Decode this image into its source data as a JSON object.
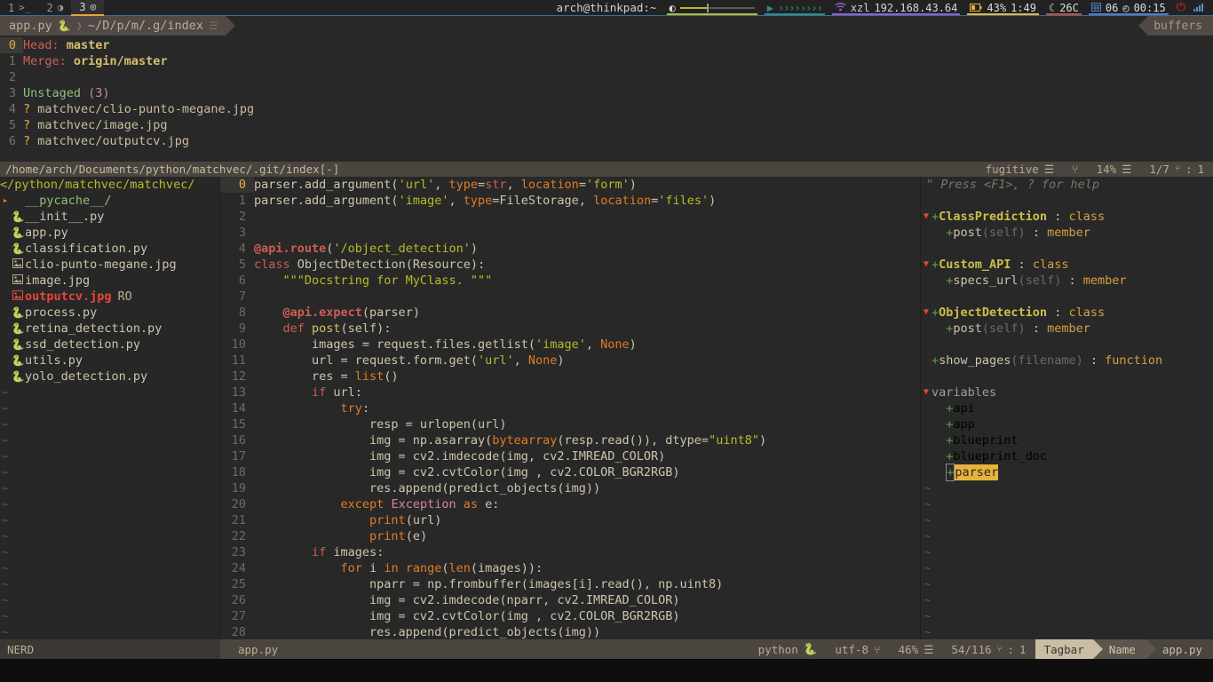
{
  "polybar": {
    "workspaces": [
      {
        "num": "1",
        "icon": ">_",
        "active": false
      },
      {
        "num": "2",
        "icon": "◑",
        "active": false
      },
      {
        "num": "3",
        "icon": "◎",
        "active": true
      }
    ],
    "window_title": "arch@thinkpad:~",
    "volume_icon": "◐",
    "audio_icon": "▶",
    "audio_wave": "››››››››",
    "wifi_icon": "wifi-icon",
    "wifi_ssid": "xzl",
    "wifi_ip": "192.168.43.64",
    "battery_icon": "battery-icon",
    "battery_percent": "43%",
    "battery_time": "1:49",
    "temp_icon": "☾",
    "temperature": "26C",
    "calendar_icon": "calendar-icon",
    "date": "06",
    "clock_icon": "◴",
    "time": "00:15",
    "power_icon": "⏻",
    "signal_icon": "signal-icon"
  },
  "tabline": {
    "tab_label": "app.py",
    "tab_icon": "python-icon",
    "tab_sep": "❯",
    "tab_path": "~/D/p/m/.g/index",
    "tab_listicon": "☰",
    "buffers_label": "buffers"
  },
  "fugitive": {
    "lines": [
      {
        "num": "0",
        "current": true,
        "kind": "kv",
        "key": "Head:",
        "value": "master"
      },
      {
        "num": "1",
        "current": false,
        "kind": "kv",
        "key": "Merge:",
        "value": "origin/master"
      },
      {
        "num": "2",
        "current": false,
        "kind": "blank"
      },
      {
        "num": "3",
        "current": false,
        "kind": "section",
        "label": "Unstaged",
        "count": "(3)"
      },
      {
        "num": "4",
        "current": false,
        "kind": "file",
        "flag": "?",
        "path": "matchvec/clio-punto-megane.jpg"
      },
      {
        "num": "5",
        "current": false,
        "kind": "file",
        "flag": "?",
        "path": "matchvec/image.jpg"
      },
      {
        "num": "6",
        "current": false,
        "kind": "file",
        "flag": "?",
        "path": "matchvec/outputcv.jpg"
      }
    ],
    "statusline": {
      "path": "/home/arch/Documents/python/matchvec/.git/index[-]",
      "filetype": "fugitive",
      "ft_icon": "☰",
      "branch_icon": "⑂",
      "percent": "14%",
      "percent_icon": "☰",
      "position": "1/7",
      "line_icon": "⑂",
      "colon": ":",
      "column": "1"
    }
  },
  "nerdtree": {
    "header": "</python/matchvec/matchvec/",
    "items": [
      {
        "icon": "folder-arrow-icon",
        "arrow": "▸",
        "label": "__pycache__/",
        "type": "dir"
      },
      {
        "icon": "python-icon",
        "label": "__init__.py",
        "type": "py"
      },
      {
        "icon": "python-icon",
        "label": "app.py",
        "type": "py"
      },
      {
        "icon": "python-icon",
        "label": "classification.py",
        "type": "py"
      },
      {
        "icon": "image-icon",
        "label": "clio-punto-megane.jpg",
        "type": "img"
      },
      {
        "icon": "image-icon",
        "label": "image.jpg",
        "type": "img"
      },
      {
        "icon": "image-icon",
        "label": "outputcv.jpg",
        "type": "img",
        "readonly": true,
        "ro_flag": "RO"
      },
      {
        "icon": "python-icon",
        "label": "process.py",
        "type": "py"
      },
      {
        "icon": "python-icon",
        "label": "retina_detection.py",
        "type": "py"
      },
      {
        "icon": "python-icon",
        "label": "ssd_detection.py",
        "type": "py"
      },
      {
        "icon": "python-icon",
        "label": "utils.py",
        "type": "py"
      },
      {
        "icon": "python-icon",
        "label": "yolo_detection.py",
        "type": "py"
      }
    ],
    "empty_marker": "~",
    "empty_rows": 16,
    "statusline_label": "NERD"
  },
  "code": {
    "filename": "app.py",
    "lines": [
      {
        "num": "0",
        "current": true,
        "tokens": [
          {
            "t": "parser.add_argument(",
            "c": "ctext"
          },
          {
            "t": "'url'",
            "c": "str"
          },
          {
            "t": ", ",
            "c": "ctext"
          },
          {
            "t": "type",
            "c": "none"
          },
          {
            "t": "=",
            "c": "ctext"
          },
          {
            "t": "str",
            "c": "kw"
          },
          {
            "t": ", ",
            "c": "ctext"
          },
          {
            "t": "location",
            "c": "none"
          },
          {
            "t": "=",
            "c": "ctext"
          },
          {
            "t": "'form'",
            "c": "str"
          },
          {
            "t": ")",
            "c": "ctext"
          }
        ]
      },
      {
        "num": "1",
        "current": false,
        "tokens": [
          {
            "t": "parser.add_argument(",
            "c": "ctext"
          },
          {
            "t": "'image'",
            "c": "str"
          },
          {
            "t": ", ",
            "c": "ctext"
          },
          {
            "t": "type",
            "c": "none"
          },
          {
            "t": "=",
            "c": "ctext"
          },
          {
            "t": "FileStorage",
            "c": "ctext"
          },
          {
            "t": ", ",
            "c": "ctext"
          },
          {
            "t": "location",
            "c": "none"
          },
          {
            "t": "=",
            "c": "ctext"
          },
          {
            "t": "'files'",
            "c": "str"
          },
          {
            "t": ")",
            "c": "ctext"
          }
        ]
      },
      {
        "num": "2",
        "current": false,
        "tokens": []
      },
      {
        "num": "3",
        "current": false,
        "tokens": []
      },
      {
        "num": "4",
        "current": false,
        "tokens": [
          {
            "t": "@api.route",
            "c": "deco"
          },
          {
            "t": "(",
            "c": "ctext"
          },
          {
            "t": "'/object_detection'",
            "c": "str"
          },
          {
            "t": ")",
            "c": "ctext"
          }
        ]
      },
      {
        "num": "5",
        "current": false,
        "tokens": [
          {
            "t": "class ",
            "c": "kw"
          },
          {
            "t": "ObjectDetection",
            "c": "cls"
          },
          {
            "t": "(Resource):",
            "c": "ctext"
          }
        ]
      },
      {
        "num": "6",
        "current": false,
        "tokens": [
          {
            "t": "    \"\"\"Docstring for MyClass. \"\"\"",
            "c": "str"
          }
        ]
      },
      {
        "num": "7",
        "current": false,
        "tokens": []
      },
      {
        "num": "8",
        "current": false,
        "tokens": [
          {
            "t": "    ",
            "c": "ctext"
          },
          {
            "t": "@api.expect",
            "c": "deco"
          },
          {
            "t": "(parser)",
            "c": "ctext"
          }
        ]
      },
      {
        "num": "9",
        "current": false,
        "tokens": [
          {
            "t": "    ",
            "c": "ctext"
          },
          {
            "t": "def ",
            "c": "kw"
          },
          {
            "t": "post",
            "c": "fn"
          },
          {
            "t": "(self):",
            "c": "ctext"
          }
        ]
      },
      {
        "num": "10",
        "current": false,
        "tokens": [
          {
            "t": "        images = request.files.getlist(",
            "c": "ctext"
          },
          {
            "t": "'image'",
            "c": "str"
          },
          {
            "t": ", ",
            "c": "ctext"
          },
          {
            "t": "None",
            "c": "none"
          },
          {
            "t": ")",
            "c": "ctext"
          }
        ]
      },
      {
        "num": "11",
        "current": false,
        "tokens": [
          {
            "t": "        url = request.form.get(",
            "c": "ctext"
          },
          {
            "t": "'url'",
            "c": "str"
          },
          {
            "t": ", ",
            "c": "ctext"
          },
          {
            "t": "None",
            "c": "none"
          },
          {
            "t": ")",
            "c": "ctext"
          }
        ]
      },
      {
        "num": "12",
        "current": false,
        "tokens": [
          {
            "t": "        res = ",
            "c": "ctext"
          },
          {
            "t": "list",
            "c": "kw2"
          },
          {
            "t": "()",
            "c": "ctext"
          }
        ]
      },
      {
        "num": "13",
        "current": false,
        "tokens": [
          {
            "t": "        ",
            "c": "ctext"
          },
          {
            "t": "if",
            "c": "kw"
          },
          {
            "t": " url:",
            "c": "ctext"
          }
        ]
      },
      {
        "num": "14",
        "current": false,
        "tokens": [
          {
            "t": "            ",
            "c": "ctext"
          },
          {
            "t": "try",
            "c": "kw2"
          },
          {
            "t": ":",
            "c": "ctext"
          }
        ]
      },
      {
        "num": "15",
        "current": false,
        "tokens": [
          {
            "t": "                resp = urlopen(url)",
            "c": "ctext"
          }
        ]
      },
      {
        "num": "16",
        "current": false,
        "tokens": [
          {
            "t": "                img = np.asarray(",
            "c": "ctext"
          },
          {
            "t": "bytearray",
            "c": "kw2"
          },
          {
            "t": "(resp.read()), dtype=",
            "c": "ctext"
          },
          {
            "t": "\"uint8\"",
            "c": "str"
          },
          {
            "t": ")",
            "c": "ctext"
          }
        ]
      },
      {
        "num": "17",
        "current": false,
        "tokens": [
          {
            "t": "                img = cv2.imdecode(img, cv2.IMREAD_COLOR)",
            "c": "ctext"
          }
        ]
      },
      {
        "num": "18",
        "current": false,
        "tokens": [
          {
            "t": "                img = cv2.cvtColor(img , cv2.COLOR_BGR2RGB)",
            "c": "ctext"
          }
        ]
      },
      {
        "num": "19",
        "current": false,
        "tokens": [
          {
            "t": "                res.append(predict_objects(img))",
            "c": "ctext"
          }
        ]
      },
      {
        "num": "20",
        "current": false,
        "tokens": [
          {
            "t": "            ",
            "c": "ctext"
          },
          {
            "t": "except ",
            "c": "kw2"
          },
          {
            "t": "Exception",
            "c": "exc"
          },
          {
            "t": " as",
            "c": "kw2"
          },
          {
            "t": " e:",
            "c": "ctext"
          }
        ]
      },
      {
        "num": "21",
        "current": false,
        "tokens": [
          {
            "t": "                ",
            "c": "ctext"
          },
          {
            "t": "print",
            "c": "kw2"
          },
          {
            "t": "(url)",
            "c": "ctext"
          }
        ]
      },
      {
        "num": "22",
        "current": false,
        "tokens": [
          {
            "t": "                ",
            "c": "ctext"
          },
          {
            "t": "print",
            "c": "kw2"
          },
          {
            "t": "(e)",
            "c": "ctext"
          }
        ]
      },
      {
        "num": "23",
        "current": false,
        "tokens": [
          {
            "t": "        ",
            "c": "ctext"
          },
          {
            "t": "if",
            "c": "kw"
          },
          {
            "t": " images:",
            "c": "ctext"
          }
        ]
      },
      {
        "num": "24",
        "current": false,
        "tokens": [
          {
            "t": "            ",
            "c": "ctext"
          },
          {
            "t": "for",
            "c": "kw2"
          },
          {
            "t": " i ",
            "c": "ctext"
          },
          {
            "t": "in",
            "c": "kw2"
          },
          {
            "t": " ",
            "c": "ctext"
          },
          {
            "t": "range",
            "c": "kw2"
          },
          {
            "t": "(",
            "c": "ctext"
          },
          {
            "t": "len",
            "c": "kw2"
          },
          {
            "t": "(images)):",
            "c": "ctext"
          }
        ]
      },
      {
        "num": "25",
        "current": false,
        "tokens": [
          {
            "t": "                nparr = np.frombuffer(images[i].read(), np.uint8)",
            "c": "ctext"
          }
        ]
      },
      {
        "num": "26",
        "current": false,
        "tokens": [
          {
            "t": "                img = cv2.imdecode(nparr, cv2.IMREAD_COLOR)",
            "c": "ctext"
          }
        ]
      },
      {
        "num": "27",
        "current": false,
        "tokens": [
          {
            "t": "                img = cv2.cvtColor(img , cv2.COLOR_BGR2RGB)",
            "c": "ctext"
          }
        ]
      },
      {
        "num": "28",
        "current": false,
        "tokens": [
          {
            "t": "                res.append(predict_objects(img))",
            "c": "ctext"
          }
        ]
      }
    ],
    "statusline": {
      "filename": "app.py",
      "filetype": "python",
      "ft_icon": "python-icon",
      "encoding": "utf-8",
      "enc_icon": "⑂",
      "percent": "46%",
      "percent_icon": "☰",
      "position": "54/116",
      "line_icon": "⑂",
      "colon": ":",
      "column": "1"
    }
  },
  "tagbar": {
    "help_text": "\" Press <F1>, ? for help",
    "rows": [
      {
        "kind": "help"
      },
      {
        "kind": "blank"
      },
      {
        "kind": "tag",
        "fold": "▼",
        "plus": "+",
        "name": "ClassPrediction",
        "sep": " : ",
        "type": "class",
        "level": 0
      },
      {
        "kind": "tag",
        "plus": "+",
        "name": "post",
        "args": "(self)",
        "sep": " : ",
        "type": "member",
        "level": 1
      },
      {
        "kind": "blank"
      },
      {
        "kind": "tag",
        "fold": "▼",
        "plus": "+",
        "name": "Custom_API",
        "sep": " : ",
        "type": "class",
        "level": 0
      },
      {
        "kind": "tag",
        "plus": "+",
        "name": "specs_url",
        "args": "(self)",
        "sep": " : ",
        "type": "member",
        "level": 1
      },
      {
        "kind": "blank"
      },
      {
        "kind": "tag",
        "fold": "▼",
        "plus": "+",
        "name": "ObjectDetection",
        "sep": " : ",
        "type": "class",
        "level": 0
      },
      {
        "kind": "tag",
        "plus": "+",
        "name": "post",
        "args": "(self)",
        "sep": " : ",
        "type": "member",
        "level": 1
      },
      {
        "kind": "blank"
      },
      {
        "kind": "func",
        "plus": "+",
        "name": "show_pages",
        "args": "(filename)",
        "sep": " : ",
        "type": "function"
      },
      {
        "kind": "blank"
      },
      {
        "kind": "group",
        "fold": "▼",
        "label": "variables"
      },
      {
        "kind": "var",
        "plus": "+",
        "name": "api"
      },
      {
        "kind": "var",
        "plus": "+",
        "name": "app"
      },
      {
        "kind": "var",
        "plus": "+",
        "name": "blueprint"
      },
      {
        "kind": "var",
        "plus": "+",
        "name": "blueprint_doc"
      },
      {
        "kind": "var",
        "plus": "+",
        "name": "parser",
        "selected": true
      }
    ],
    "empty_marker": "~",
    "empty_rows": 11,
    "statusline": {
      "label": "Tagbar",
      "sort": "Name",
      "file": "app.py"
    }
  }
}
